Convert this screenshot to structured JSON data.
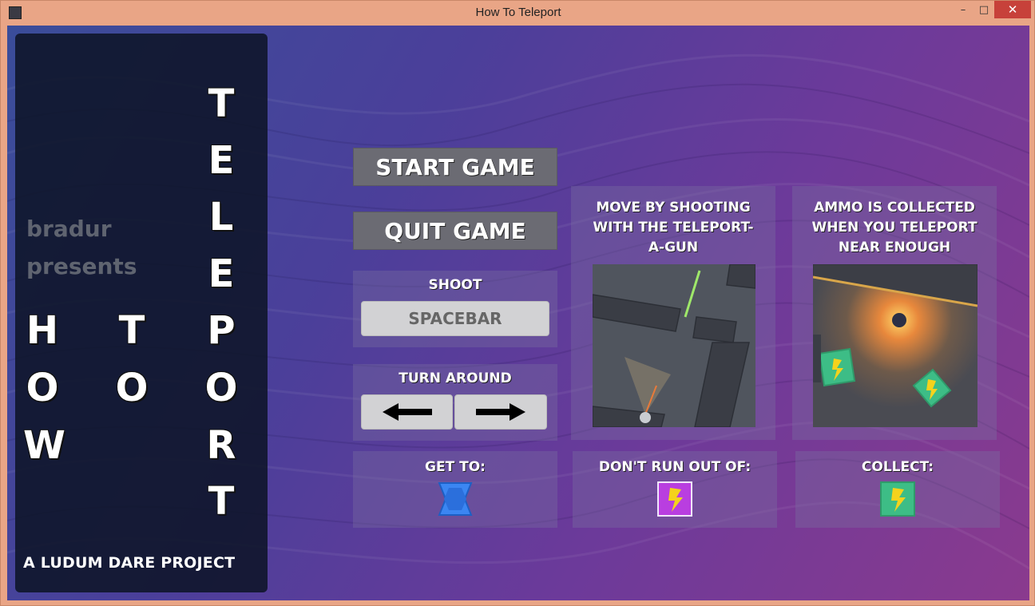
{
  "window": {
    "title": "How To Teleport",
    "minimize_glyph": "–",
    "maximize_glyph": "□",
    "close_glyph": "✕"
  },
  "sidebar": {
    "presenter": "bradur",
    "presents": "presents",
    "word_how": [
      "H",
      "O",
      "W"
    ],
    "word_to": [
      "T",
      "O"
    ],
    "word_teleport": [
      "T",
      "E",
      "L",
      "E",
      "P",
      "O",
      "R",
      "T"
    ],
    "credit": "A LUDUM DARE PROJECT"
  },
  "menu": {
    "start_label": "START GAME",
    "quit_label": "QUIT GAME"
  },
  "controls": {
    "shoot_heading": "SHOOT",
    "shoot_key": "SPACEBAR",
    "turn_heading": "TURN AROUND",
    "turn_left_icon": "left-arrow-icon",
    "turn_right_icon": "right-arrow-icon"
  },
  "tips": {
    "move_text": "MOVE BY SHOOTING WITH THE TELEPORT-A-GUN",
    "ammo_text": "AMMO IS COLLECTED WHEN YOU TELEPORT NEAR ENOUGH"
  },
  "goals": {
    "get_to_heading": "GET TO:",
    "get_to_icon": "blue-portal-icon",
    "dont_run_out_heading": "DON'T RUN OUT OF:",
    "dont_run_out_icon": "purple-lightning-icon",
    "collect_heading": "COLLECT:",
    "collect_icon": "green-lightning-icon"
  },
  "colors": {
    "portal_blue": "#3b86f2",
    "energy_purple": "#b93ee0",
    "ammo_green": "#3dbd86",
    "lightning_yellow": "#f4d21c"
  }
}
